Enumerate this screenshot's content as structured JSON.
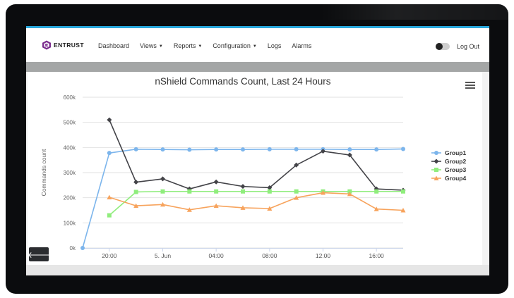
{
  "app": {
    "brand": "ENTRUST",
    "nav": [
      {
        "label": "Dashboard",
        "dropdown": false
      },
      {
        "label": "Views",
        "dropdown": true
      },
      {
        "label": "Reports",
        "dropdown": true
      },
      {
        "label": "Configuration",
        "dropdown": true
      },
      {
        "label": "Logs",
        "dropdown": false
      },
      {
        "label": "Alarms",
        "dropdown": false
      }
    ],
    "logout_label": "Log Out",
    "back_icon": "arrow-left-icon",
    "menu_icon": "hamburger-menu-icon",
    "colors": {
      "accent": "#29a8dc",
      "brand": "#7b2d8e"
    }
  },
  "chart_data": {
    "type": "line",
    "title": "nShield Commands Count, Last 24 Hours",
    "ylabel": "Commands count",
    "xlabel": "",
    "ylim": [
      0,
      600000
    ],
    "yticks": [
      0,
      100000,
      200000,
      300000,
      400000,
      500000,
      600000
    ],
    "ytick_labels": [
      "0k",
      "100k",
      "200k",
      "300k",
      "400k",
      "500k",
      "600k"
    ],
    "xlim": [
      18,
      42
    ],
    "xticks": [
      20,
      24,
      28,
      32,
      36,
      40
    ],
    "xtick_labels": [
      "20:00",
      "5. Jun",
      "04:00",
      "08:00",
      "12:00",
      "16:00"
    ],
    "grid": true,
    "legend": "right",
    "series": [
      {
        "name": "Group1",
        "color": "#7cb5ec",
        "marker": "circle",
        "x": [
          18,
          20,
          22,
          24,
          26,
          28,
          30,
          32,
          34,
          36,
          38,
          40,
          42
        ],
        "y": [
          0,
          378000,
          393000,
          392000,
          391000,
          392000,
          392000,
          393000,
          393000,
          393000,
          392000,
          392000,
          394000
        ]
      },
      {
        "name": "Group2",
        "color": "#434348",
        "marker": "diamond",
        "x": [
          20,
          22,
          24,
          26,
          28,
          30,
          32,
          34,
          36,
          38,
          40,
          42
        ],
        "y": [
          510000,
          262000,
          275000,
          235000,
          263000,
          245000,
          240000,
          330000,
          385000,
          370000,
          235000,
          230000
        ]
      },
      {
        "name": "Group3",
        "color": "#90ed7d",
        "marker": "square",
        "x": [
          20,
          22,
          24,
          26,
          28,
          30,
          32,
          34,
          36,
          38,
          40,
          42
        ],
        "y": [
          130000,
          223000,
          225000,
          225000,
          225000,
          225000,
          225000,
          225000,
          225000,
          225000,
          225000,
          225000
        ]
      },
      {
        "name": "Group4",
        "color": "#f7a35c",
        "marker": "triangle",
        "x": [
          20,
          22,
          24,
          26,
          28,
          30,
          32,
          34,
          36,
          38,
          40,
          42
        ],
        "y": [
          202000,
          168000,
          173000,
          152000,
          168000,
          160000,
          157000,
          200000,
          220000,
          215000,
          155000,
          150000
        ]
      }
    ]
  }
}
